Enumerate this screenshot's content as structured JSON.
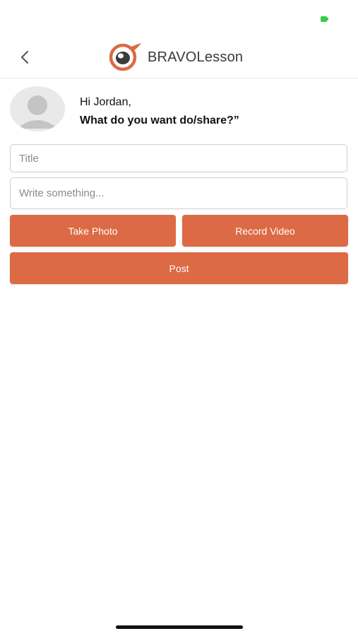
{
  "header": {
    "brand_name": "BRAVOLesson",
    "accent_color": "#dc6a45",
    "back_icon": "chevron-left-icon",
    "logo_icon": "eye-logo-icon"
  },
  "status_bar": {
    "battery_icon": "battery-icon"
  },
  "profile": {
    "avatar_icon": "default-user-avatar-icon",
    "greeting": "Hi Jordan,",
    "prompt": "What do you want do/share?”"
  },
  "form": {
    "title_value": "",
    "title_placeholder": "Title",
    "body_value": "",
    "body_placeholder": "Write something..."
  },
  "actions": {
    "take_photo_label": "Take Photo",
    "record_video_label": "Record Video",
    "post_label": "Post"
  }
}
